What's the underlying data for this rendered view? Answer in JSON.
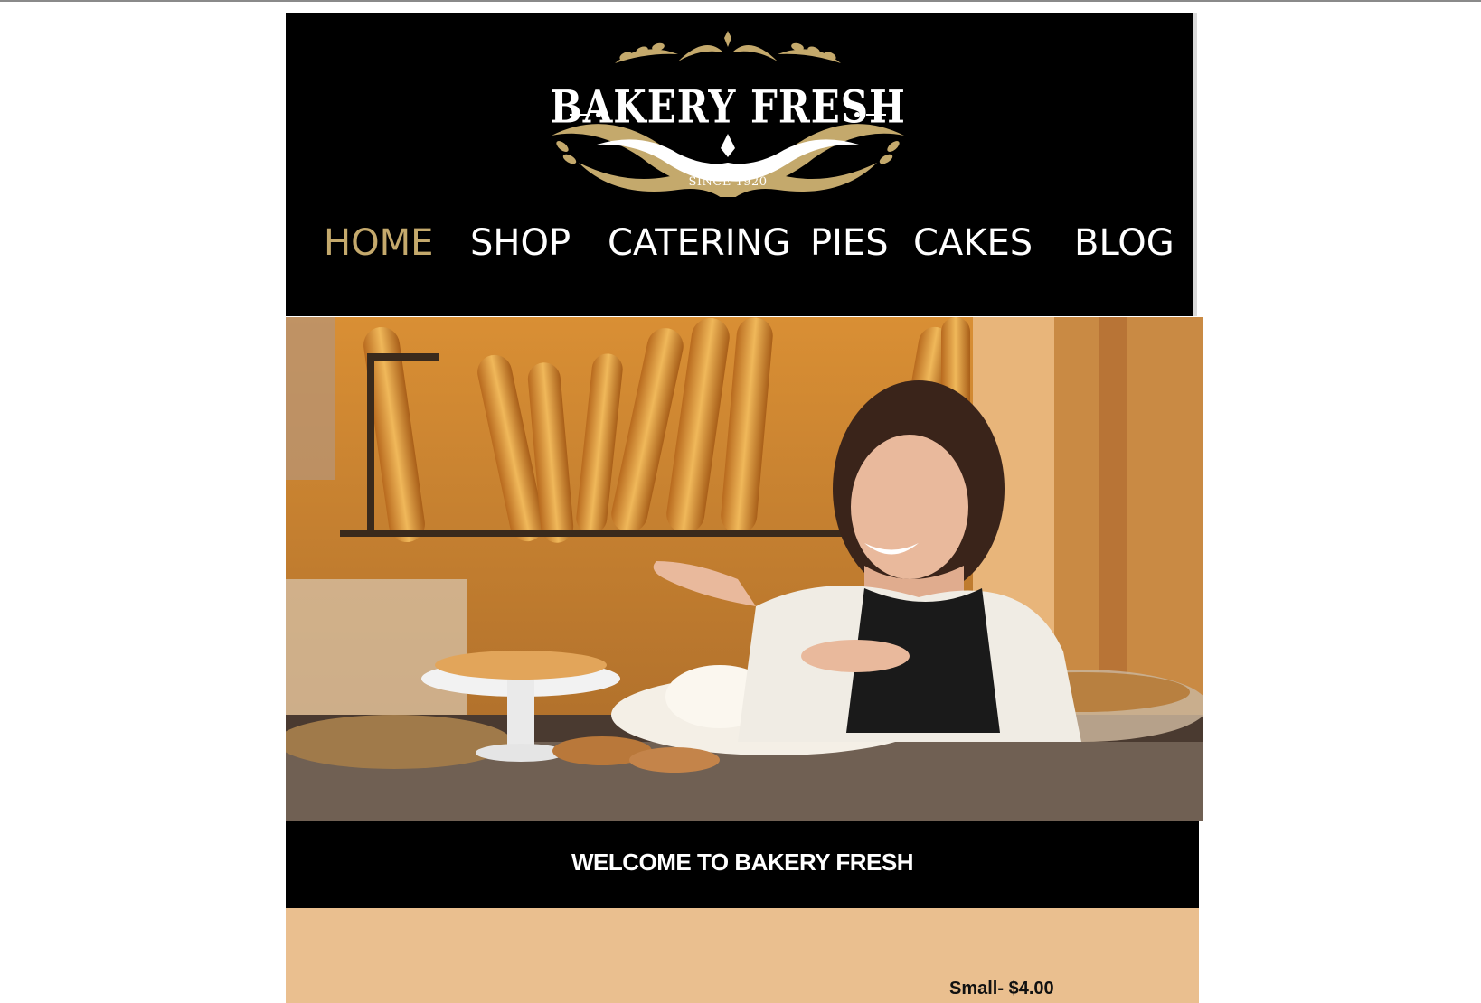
{
  "brand": {
    "name": "BAKERY FRESH",
    "since": "SINCE 1920"
  },
  "nav": {
    "items": [
      {
        "label": "HOME",
        "active": true
      },
      {
        "label": "SHOP",
        "active": false
      },
      {
        "label": "CATERING",
        "active": false
      },
      {
        "label": "PIES",
        "active": false
      },
      {
        "label": "CAKES",
        "active": false
      },
      {
        "label": "BLOG",
        "active": false
      }
    ]
  },
  "welcome": {
    "title": "WELCOME TO BAKERY FRESH"
  },
  "products": {
    "price_small": "Small- $4.00"
  },
  "colors": {
    "accent_gold": "#c4a96c",
    "header_bg": "#000000",
    "panel_tan": "#eabf8f"
  }
}
